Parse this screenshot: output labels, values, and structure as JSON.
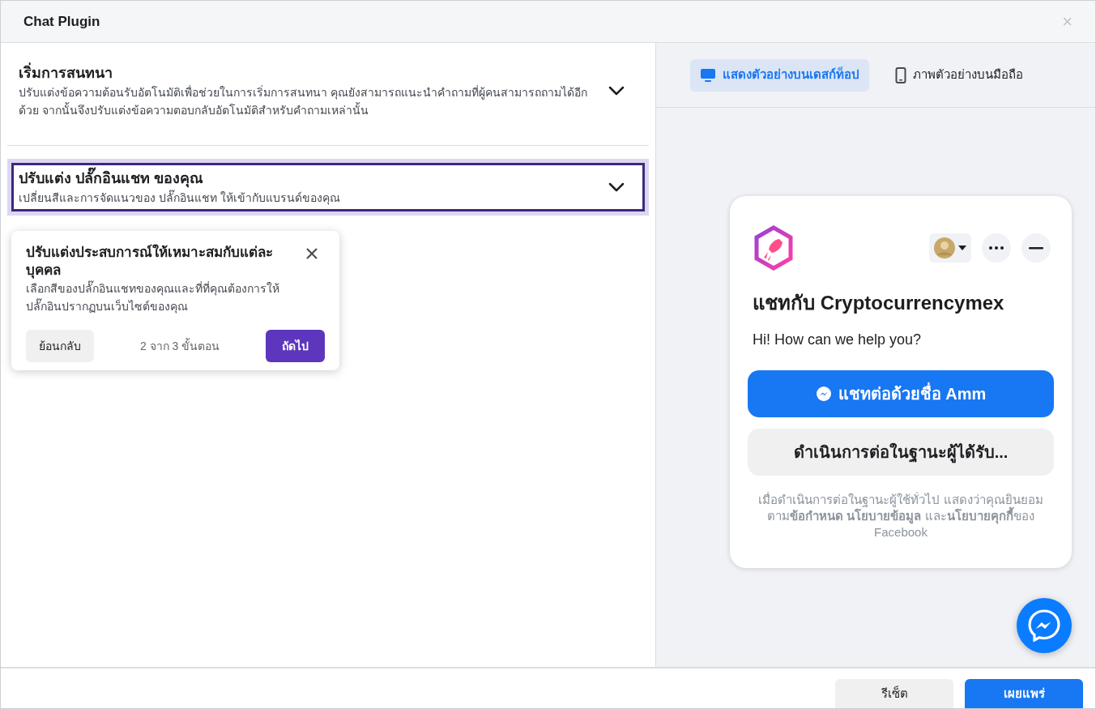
{
  "window": {
    "title": "Chat Plugin",
    "close": "×"
  },
  "sections": [
    {
      "title": "เริ่มการสนทนา",
      "description": "ปรับแต่งข้อความต้อนรับอัตโนมัติเพื่อช่วยในการเริ่มการสนทนา คุณยังสามารถแนะนำคำถามที่ผู้คนสามารถถามได้อีกด้วย จากนั้นจึงปรับแต่งข้อความตอบกลับอัตโนมัติสำหรับคำถามเหล่านั้น",
      "expanded": false,
      "highlighted": false
    },
    {
      "title": "ปรับแต่ง ปลั๊กอินแชท ของคุณ",
      "description": "เปลี่ยนสีและการจัดแนวของ ปลั๊กอินแชท ให้เข้ากับแบรนด์ของคุณ",
      "expanded": false,
      "highlighted": true
    }
  ],
  "tour": {
    "title": "ปรับแต่งประสบการณ์ให้เหมาะสมกับแต่ละบุคคล",
    "body": "เลือกสีของปลั๊กอินแชทของคุณและที่ที่คุณต้องการให้ปลั๊กอินปรากฏบนเว็บไซต์ของคุณ",
    "back": "ย้อนกลับ",
    "progress": "2 จาก 3 ขั้นตอน",
    "next": "ถัดไป"
  },
  "preview_tabs": [
    {
      "label": "แสดงตัวอย่างบนเดสก์ท็อป",
      "kind": "desktop",
      "selected": true
    },
    {
      "label": "ภาพตัวอย่างบนมือถือ",
      "kind": "mobile",
      "selected": false
    }
  ],
  "chat_preview": {
    "heading": "แชทกับ Cryptocurrencymex",
    "greeting": "Hi! How can we help you?",
    "primary_button": "แชทต่อด้วยชื่อ Amm",
    "secondary_button": "ดำเนินการต่อในฐานะผู้ได้รับ...",
    "legal": "เมื่อดำเนินการต่อในฐานะผู้ใช้ทั่วไป แสดงว่าคุณยินยอมตาม**ข้อกำหนด นโยบายข้อมูล** และ**นโยบายคุกกี้**ของ Facebook"
  },
  "footer": {
    "buttons": [
      {
        "label": "รีเซ็ต",
        "kind": "secondary"
      },
      {
        "label": "เผยแพร่",
        "kind": "primary"
      }
    ]
  }
}
